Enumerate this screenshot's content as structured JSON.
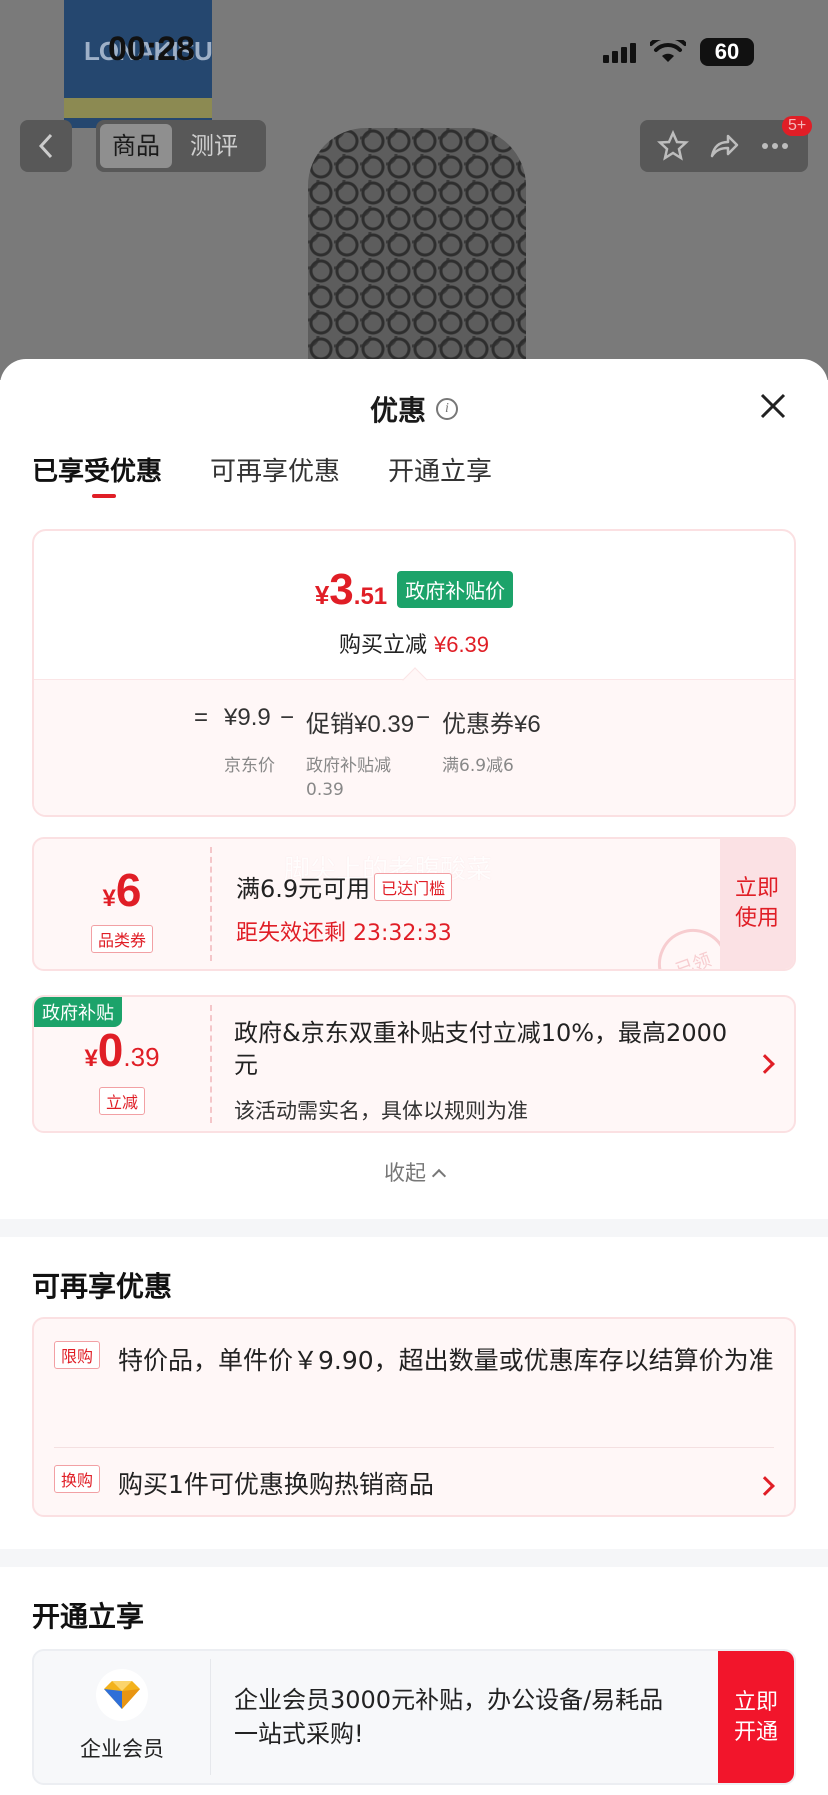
{
  "status_bar": {
    "time": "00:28",
    "battery": "60"
  },
  "background_page": {
    "logo_text": "LONAKISU",
    "tabs": [
      "商品",
      "测评"
    ],
    "badge": "5+"
  },
  "sheet": {
    "title": "优惠",
    "tabs": [
      "已享受优惠",
      "可再享优惠",
      "开通立享"
    ],
    "price_card": {
      "currency": "¥",
      "price_int": "3",
      "price_dec": ".51",
      "price_tag": "政府补贴价",
      "save_label": "购买立减",
      "save_amount": "¥6.39",
      "breakdown": {
        "equals": "=",
        "jd_price": "¥9.9",
        "minus1": "−",
        "promo": "促销¥0.39",
        "minus2": "−",
        "coupon": "优惠券¥6",
        "jd_price_label": "京东价",
        "promo_label": "政府补贴减0.39",
        "coupon_label": "满6.9减6"
      }
    },
    "coupon_card": {
      "currency": "¥",
      "amount": "6",
      "type_tag": "品类券",
      "condition": "满6.9元可用",
      "threshold_tag": "已达门槛",
      "countdown": "距失效还剩 23:32:33",
      "button": "立即使用",
      "stamp": "已领",
      "watermark": "脚尖上的老腹酸菜"
    },
    "subsidy_card": {
      "flag": "政府补贴",
      "currency": "¥",
      "amount_int": "0",
      "amount_dec": ".39",
      "type_tag": "立减",
      "description": "政府&京东双重补贴支付立减10%，最高2000元",
      "note": "该活动需实名，具体以规则为准"
    },
    "collapse_label": "收起",
    "more_section": {
      "title": "可再享优惠",
      "items": [
        {
          "tag": "限购",
          "text": "特价品，单件价￥9.90，超出数量或优惠库存以结算价为准"
        },
        {
          "tag": "换购",
          "text": "购买1件可优惠换购热销商品"
        }
      ]
    },
    "open_section": {
      "title": "开通立享",
      "member_label": "企业会员",
      "description": "企业会员3000元补贴，办公设备/易耗品一站式采购!",
      "button": "立即开通"
    }
  },
  "colors": {
    "accent_red": "#e01e26",
    "gov_green": "#1ca36a",
    "cta_red": "#f2152b"
  }
}
